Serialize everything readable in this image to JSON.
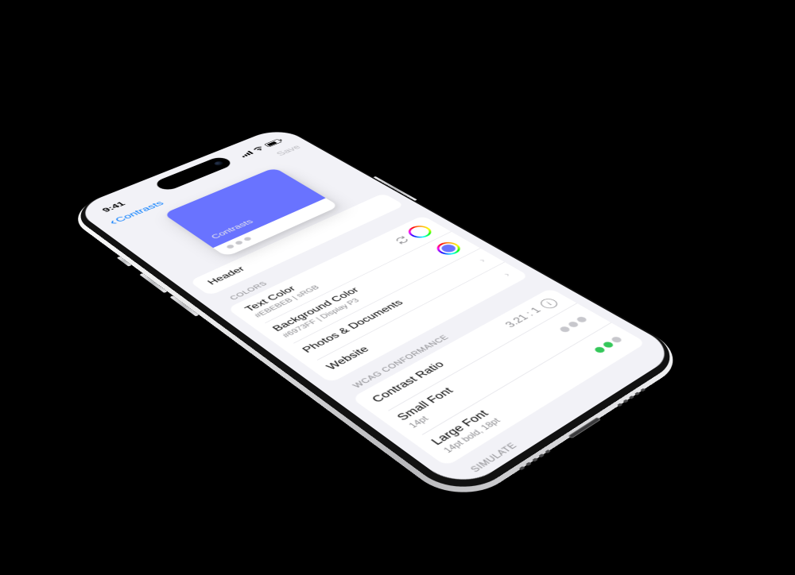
{
  "status": {
    "time": "9:41"
  },
  "nav": {
    "back": "Contrasts",
    "save": "Save"
  },
  "preview": {
    "label": "Contrasts",
    "swatchColor": "#6973FF",
    "textColor": "#EBEBEB"
  },
  "nameField": {
    "value": "Header"
  },
  "sections": {
    "colors": {
      "title": "COLORS",
      "rows": {
        "textColor": {
          "label": "Text Color",
          "sub": "#EBEBEB | sRGB"
        },
        "bgColor": {
          "label": "Background Color",
          "sub": "#6973FF | Display P3"
        },
        "photos": {
          "label": "Photos & Documents"
        },
        "website": {
          "label": "Website"
        }
      }
    },
    "wcag": {
      "title": "WCAG CONFORMANCE",
      "rows": {
        "ratio": {
          "label": "Contrast Ratio",
          "value": "3.21 : 1"
        },
        "small": {
          "label": "Small Font",
          "sub": "14pt"
        },
        "large": {
          "label": "Large Font",
          "sub": "14pt bold, 18pt"
        }
      }
    },
    "simulate": {
      "title": "SIMULATE"
    }
  }
}
